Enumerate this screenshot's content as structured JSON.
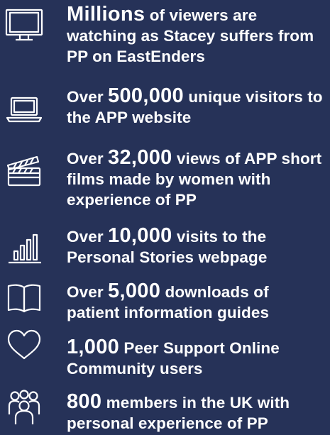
{
  "stats": [
    {
      "icon": "tv-icon",
      "prefix": "",
      "number": "Millions",
      "suffix": " of viewers are watching as Stacey suffers from PP on EastEnders"
    },
    {
      "icon": "laptop-icon",
      "prefix": "Over ",
      "number": "500,000",
      "suffix": " unique visitors to the APP website"
    },
    {
      "icon": "clapperboard-icon",
      "prefix": "Over ",
      "number": "32,000",
      "suffix": " views of APP short films made by women with experience of PP"
    },
    {
      "icon": "bar-chart-icon",
      "prefix": "Over ",
      "number": "10,000",
      "suffix": " visits to the Personal Stories webpage"
    },
    {
      "icon": "book-icon",
      "prefix": "Over ",
      "number": "5,000",
      "suffix": " downloads of patient information guides"
    },
    {
      "icon": "heart-icon",
      "prefix": "",
      "number": "1,000",
      "suffix": " Peer Support Online Community users"
    },
    {
      "icon": "people-icon",
      "prefix": "",
      "number": "800",
      "suffix": " members in the UK with personal experience of PP"
    }
  ]
}
